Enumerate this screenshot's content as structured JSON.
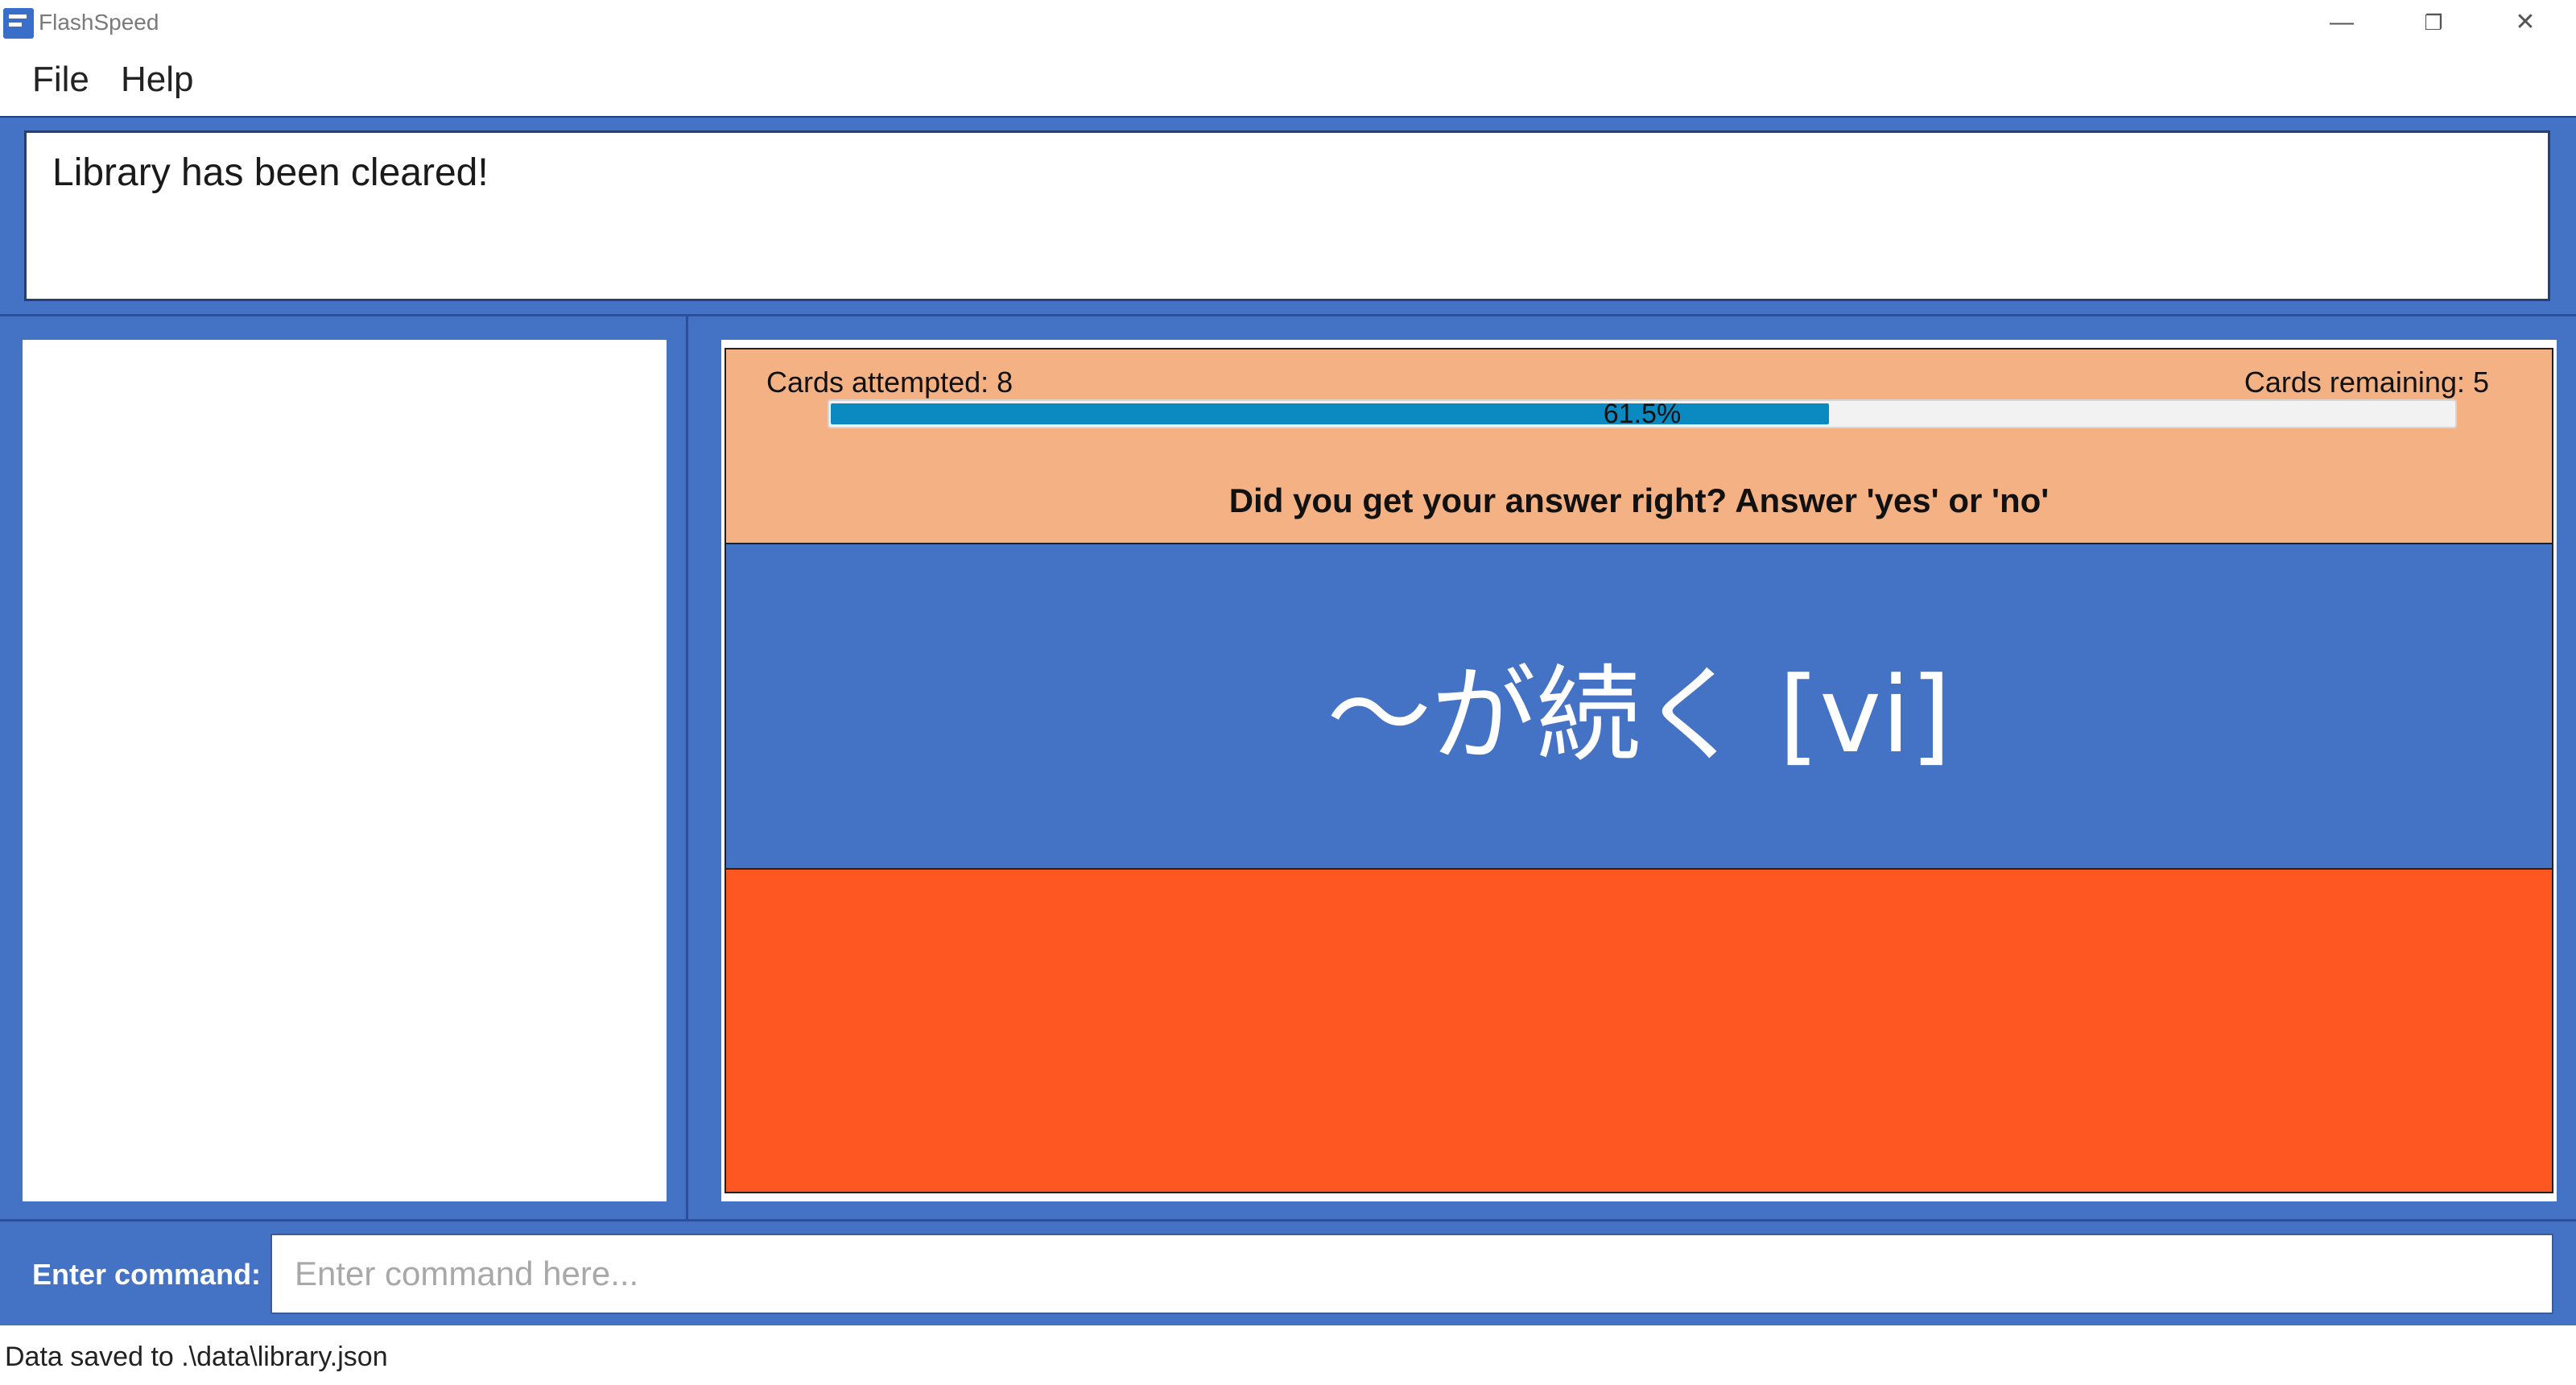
{
  "window": {
    "title": "FlashSpeed",
    "controls": {
      "minimize": "—",
      "restore": "❐",
      "close": "✕"
    }
  },
  "menu": {
    "items": [
      {
        "label": "File"
      },
      {
        "label": "Help"
      }
    ]
  },
  "result": {
    "message": "Library has been cleared!"
  },
  "review": {
    "attempted_label": "Cards attempted: 8",
    "remaining_label": "Cards remaining: 5",
    "progress_text": "61.5%",
    "progress_fraction": 0.615,
    "prompt": "Did you get your answer right? Answer 'yes' or 'no'",
    "question": "～が続く [vi]",
    "answer": ""
  },
  "command": {
    "label": "Enter command:",
    "value": "",
    "placeholder": "Enter command here..."
  },
  "status": {
    "text": "Data saved to .\\data\\library.json"
  },
  "colors": {
    "frame": "#4472c4",
    "stats_bg": "#f4b183",
    "question_bg": "#4472c4",
    "answer_bg": "#ff5722",
    "progress_fill": "#0b8ac1"
  }
}
